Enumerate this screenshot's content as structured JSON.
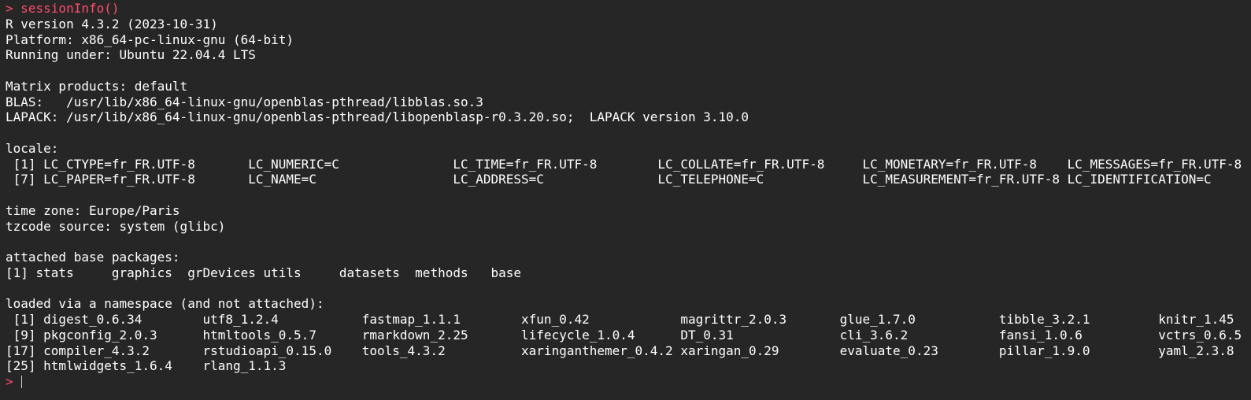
{
  "console": {
    "prompt_symbol": "> ",
    "command": "sessionInfo()",
    "output": [
      "R version 4.3.2 (2023-10-31)",
      "Platform: x86_64-pc-linux-gnu (64-bit)",
      "Running under: Ubuntu 22.04.4 LTS",
      "",
      "Matrix products: default",
      "BLAS:   /usr/lib/x86_64-linux-gnu/openblas-pthread/libblas.so.3",
      "LAPACK: /usr/lib/x86_64-linux-gnu/openblas-pthread/libopenblasp-r0.3.20.so;  LAPACK version 3.10.0",
      "",
      "locale:",
      " [1] LC_CTYPE=fr_FR.UTF-8       LC_NUMERIC=C               LC_TIME=fr_FR.UTF-8        LC_COLLATE=fr_FR.UTF-8     LC_MONETARY=fr_FR.UTF-8    LC_MESSAGES=fr_FR.UTF-8",
      " [7] LC_PAPER=fr_FR.UTF-8       LC_NAME=C                  LC_ADDRESS=C               LC_TELEPHONE=C             LC_MEASUREMENT=fr_FR.UTF-8 LC_IDENTIFICATION=C",
      "",
      "time zone: Europe/Paris",
      "tzcode source: system (glibc)",
      "",
      "attached base packages:",
      "[1] stats     graphics  grDevices utils     datasets  methods   base",
      "",
      "loaded via a namespace (and not attached):",
      " [1] digest_0.6.34        utf8_1.2.4           fastmap_1.1.1        xfun_0.42            magrittr_2.0.3       glue_1.7.0           tibble_3.2.1         knitr_1.45",
      " [9] pkgconfig_2.0.3      htmltools_0.5.7      rmarkdown_2.25       lifecycle_1.0.4      DT_0.31              cli_3.6.2            fansi_1.0.6          vctrs_0.6.5",
      "[17] compiler_4.3.2       rstudioapi_0.15.0    tools_4.3.2          xaringanthemer_0.4.2 xaringan_0.29        evaluate_0.23        pillar_1.9.0         yaml_2.3.8",
      "[25] htmlwidgets_1.6.4    rlang_1.1.3"
    ],
    "input_value": ""
  },
  "colors": {
    "background": "#262626",
    "output_text": "#ffffff",
    "prompt": "#ff4d6d"
  }
}
